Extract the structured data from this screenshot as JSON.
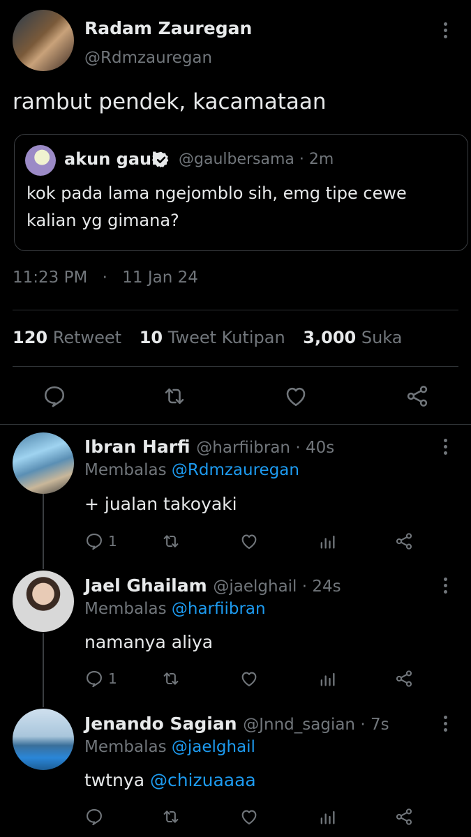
{
  "main_tweet": {
    "author_name": "Radam Zauregan",
    "author_handle": "@Rdmzauregan",
    "text": "rambut pendek, kacamataan",
    "quoted": {
      "name": "akun gaul",
      "handle_time": "@gaulbersama · 2m",
      "text": "kok pada lama ngejomblo sih, emg tipe cewe kalian yg gimana?"
    },
    "time": "11:23 PM",
    "date": "11 Jan 24",
    "separator": "·",
    "stats": {
      "retweet_count": "120",
      "retweet_label": "Retweet",
      "quote_count": "10",
      "quote_label": "Tweet Kutipan",
      "like_count": "3,000",
      "like_label": "Suka"
    }
  },
  "replies": [
    {
      "name": "Ibran Harfi",
      "handle_time": "@harfiibran · 40s",
      "replying_prefix": "Membalas",
      "replying_to": "@Rdmzauregan",
      "text": "+ jualan takoyaki",
      "reply_count": "1"
    },
    {
      "name": "Jael Ghailam",
      "handle_time": "@jaelghail · 24s",
      "replying_prefix": "Membalas",
      "replying_to": "@harfiibran",
      "text": "namanya aliya",
      "reply_count": "1"
    },
    {
      "name": "Jenando Sagian",
      "handle_time": "@Jnnd_sagian · 7s",
      "replying_prefix": "Membalas",
      "replying_to": "@jaelghail",
      "text_prefix": "twtnya ",
      "text_mention": "@chizuaaaa",
      "reply_count": ""
    }
  ],
  "colors": {
    "background": "#000000",
    "text": "#e7e9ea",
    "muted": "#71767b",
    "link": "#1d9bf0",
    "divider": "#2f3336"
  }
}
